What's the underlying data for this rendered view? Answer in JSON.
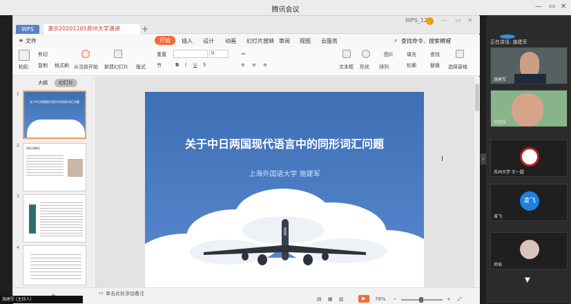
{
  "window": {
    "title": "腾讯会议",
    "controls": [
      "—",
      "▭",
      "✕"
    ]
  },
  "wps": {
    "tab_app": "WPS",
    "tab_doc": "20201105苏州大学演讲",
    "tab_doc_prefix": "演示",
    "user": "WPS_12...",
    "menu": [
      "文件",
      "开始",
      "插入",
      "设计",
      "动画",
      "幻灯片放映",
      "审阅",
      "视图",
      "云服务"
    ],
    "menu_active": "开始",
    "search_placeholder": "查找命令、搜索模板",
    "ribbon": {
      "paste": "粘贴",
      "cut": "剪切",
      "copy": "复制",
      "format_brush": "格式刷",
      "from_start": "从当前开始",
      "new_slide": "新建幻灯片",
      "layout": "版式",
      "reset": "重置",
      "section": "节",
      "font_size": "0",
      "textbox": "文本框",
      "shape": "形状",
      "arrange": "排列",
      "picture": "图片",
      "fill": "填充",
      "outline": "轮廓",
      "find": "查找",
      "replace": "替换",
      "select": "选择",
      "select_pane": "选择窗格"
    },
    "panel_tabs": [
      "大纲",
      "幻灯片"
    ],
    "thumbs": [
      {
        "num": "1",
        "title": "关于中日两国现代语言中的同形词汇问题"
      },
      {
        "num": "2",
        "title": "同形词概况"
      },
      {
        "num": "3",
        "title": ""
      },
      {
        "num": "4",
        "title": ""
      }
    ],
    "slide": {
      "title": "关于中日两国现代语言中的同形词汇问题",
      "subtitle": "上海外国语大学 施建军"
    },
    "status": {
      "notes": "单击此处添加备注",
      "file": "20140530A99PPBG",
      "zoom": "78%"
    }
  },
  "side": {
    "header": "正在讲话: 施建军",
    "participants": [
      {
        "name": "施建军"
      },
      {
        "name": "宗欣军"
      },
      {
        "name": "苏州大学 王一超"
      },
      {
        "name": "凌飞",
        "avatar_text": "凌飞"
      },
      {
        "name": "邓伯"
      }
    ]
  },
  "bottom_left": "施建军 (主持人)"
}
